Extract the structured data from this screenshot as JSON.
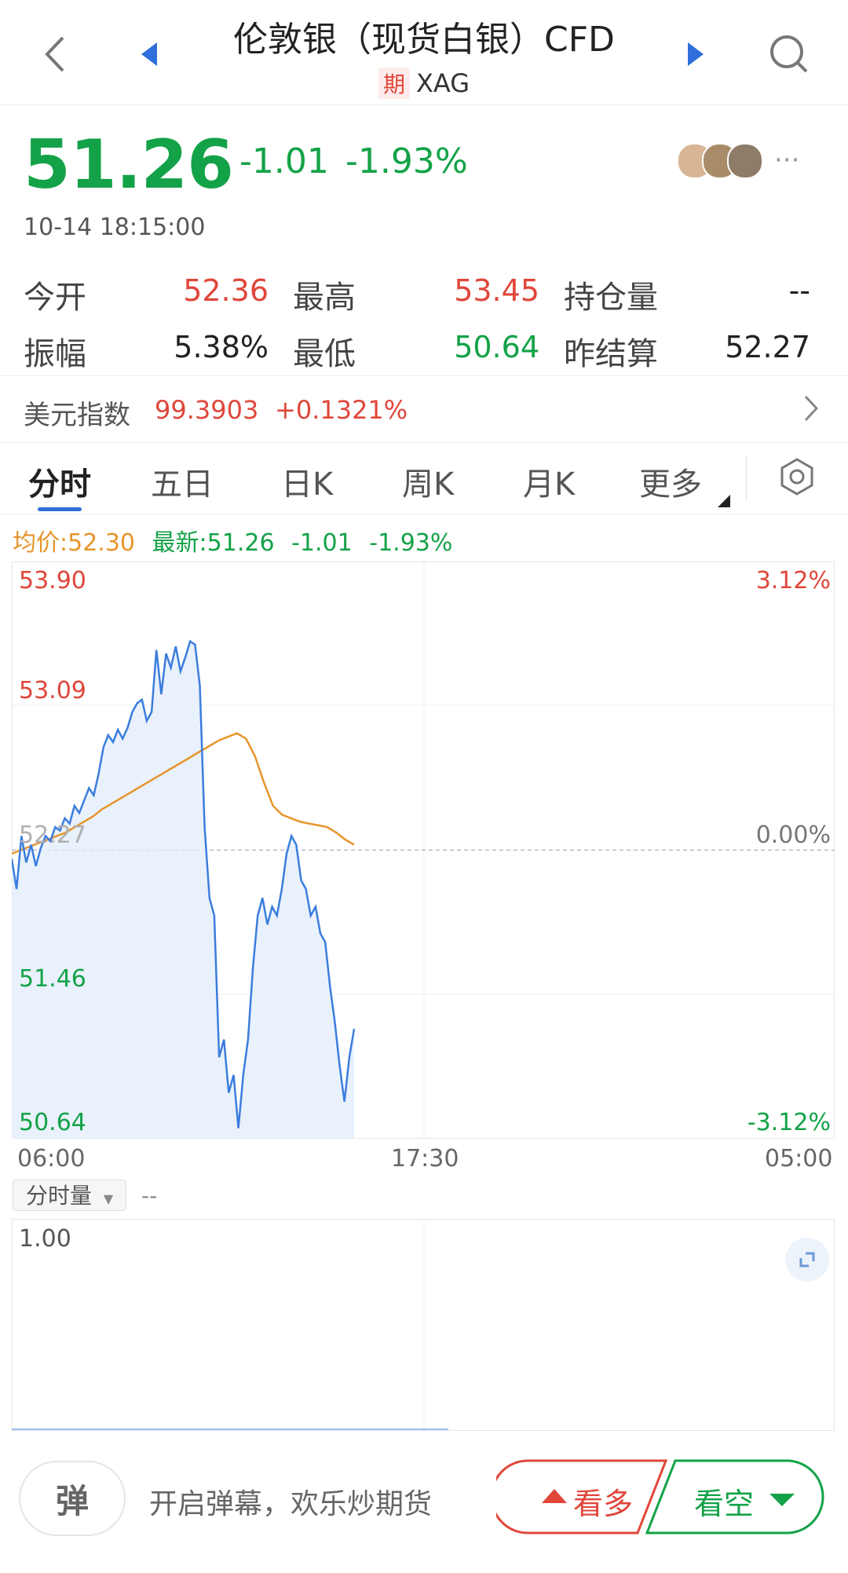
{
  "header": {
    "title": "伦敦银（现货白银）CFD",
    "badge": "期",
    "symbol": "XAG"
  },
  "quote": {
    "price": "51.26",
    "change": "-1.01",
    "change_pct": "-1.93%",
    "timestamp": "10-14 18:15:00"
  },
  "stats": {
    "open_label": "今开",
    "open": "52.36",
    "high_label": "最高",
    "high": "53.45",
    "oi_label": "持仓量",
    "oi": "--",
    "amp_label": "振幅",
    "amp": "5.38%",
    "low_label": "最低",
    "low": "50.64",
    "prev_settle_label": "昨结算",
    "prev_settle": "52.27"
  },
  "usd_index": {
    "label": "美元指数",
    "value": "99.3903",
    "change": "+0.1321%"
  },
  "tabs": [
    "分时",
    "五日",
    "日K",
    "周K",
    "月K",
    "更多"
  ],
  "legend": {
    "avg": "均价:52.30",
    "latest": "最新:51.26",
    "change": "-1.01",
    "pct": "-1.93%"
  },
  "chart_data": {
    "type": "line",
    "y_ticks_left": [
      "53.90",
      "53.09",
      "51.46",
      "50.64"
    ],
    "y_ticks_right": [
      "3.12%",
      "0.00%",
      "-3.12%"
    ],
    "baseline_label": "52.27",
    "x_ticks": [
      "06:00",
      "17:30",
      "05:00"
    ],
    "ylim": [
      50.64,
      53.9
    ],
    "baseline": 52.27,
    "colors": {
      "price": "#3b7ddd",
      "avg": "#e6952b",
      "fill": "#e3eefb"
    },
    "series": [
      {
        "name": "最新",
        "values": [
          52.22,
          52.05,
          52.35,
          52.2,
          52.3,
          52.18,
          52.28,
          52.35,
          52.32,
          52.4,
          52.38,
          52.45,
          52.42,
          52.52,
          52.48,
          52.55,
          52.62,
          52.58,
          52.7,
          52.85,
          52.92,
          52.88,
          52.95,
          52.9,
          52.96,
          53.05,
          53.1,
          53.12,
          53.0,
          53.05,
          53.4,
          53.15,
          53.38,
          53.3,
          53.42,
          53.28,
          53.36,
          53.45,
          53.43,
          53.2,
          52.4,
          52.0,
          51.9,
          51.1,
          51.2,
          50.9,
          51.0,
          50.7,
          51.0,
          51.2,
          51.6,
          51.9,
          52.0,
          51.85,
          51.95,
          51.9,
          52.05,
          52.25,
          52.35,
          52.3,
          52.1,
          52.05,
          51.9,
          51.95,
          51.8,
          51.75,
          51.5,
          51.3,
          51.05,
          50.85,
          51.1,
          51.26
        ]
      },
      {
        "name": "均价",
        "values": [
          52.25,
          52.27,
          52.29,
          52.31,
          52.33,
          52.35,
          52.37,
          52.4,
          52.43,
          52.46,
          52.5,
          52.53,
          52.56,
          52.59,
          52.62,
          52.65,
          52.68,
          52.71,
          52.74,
          52.77,
          52.8,
          52.83,
          52.86,
          52.89,
          52.91,
          52.93,
          52.9,
          52.8,
          52.65,
          52.52,
          52.47,
          52.45,
          52.43,
          52.42,
          52.41,
          52.4,
          52.37,
          52.33,
          52.3
        ]
      }
    ]
  },
  "volume": {
    "selector": "分时量",
    "value": "--",
    "y_tick": "1.00"
  },
  "bottom": {
    "danmu_icon": "弹",
    "danmu_text": "开启弹幕，欢乐炒期货",
    "long_label": "看多",
    "short_label": "看空"
  }
}
